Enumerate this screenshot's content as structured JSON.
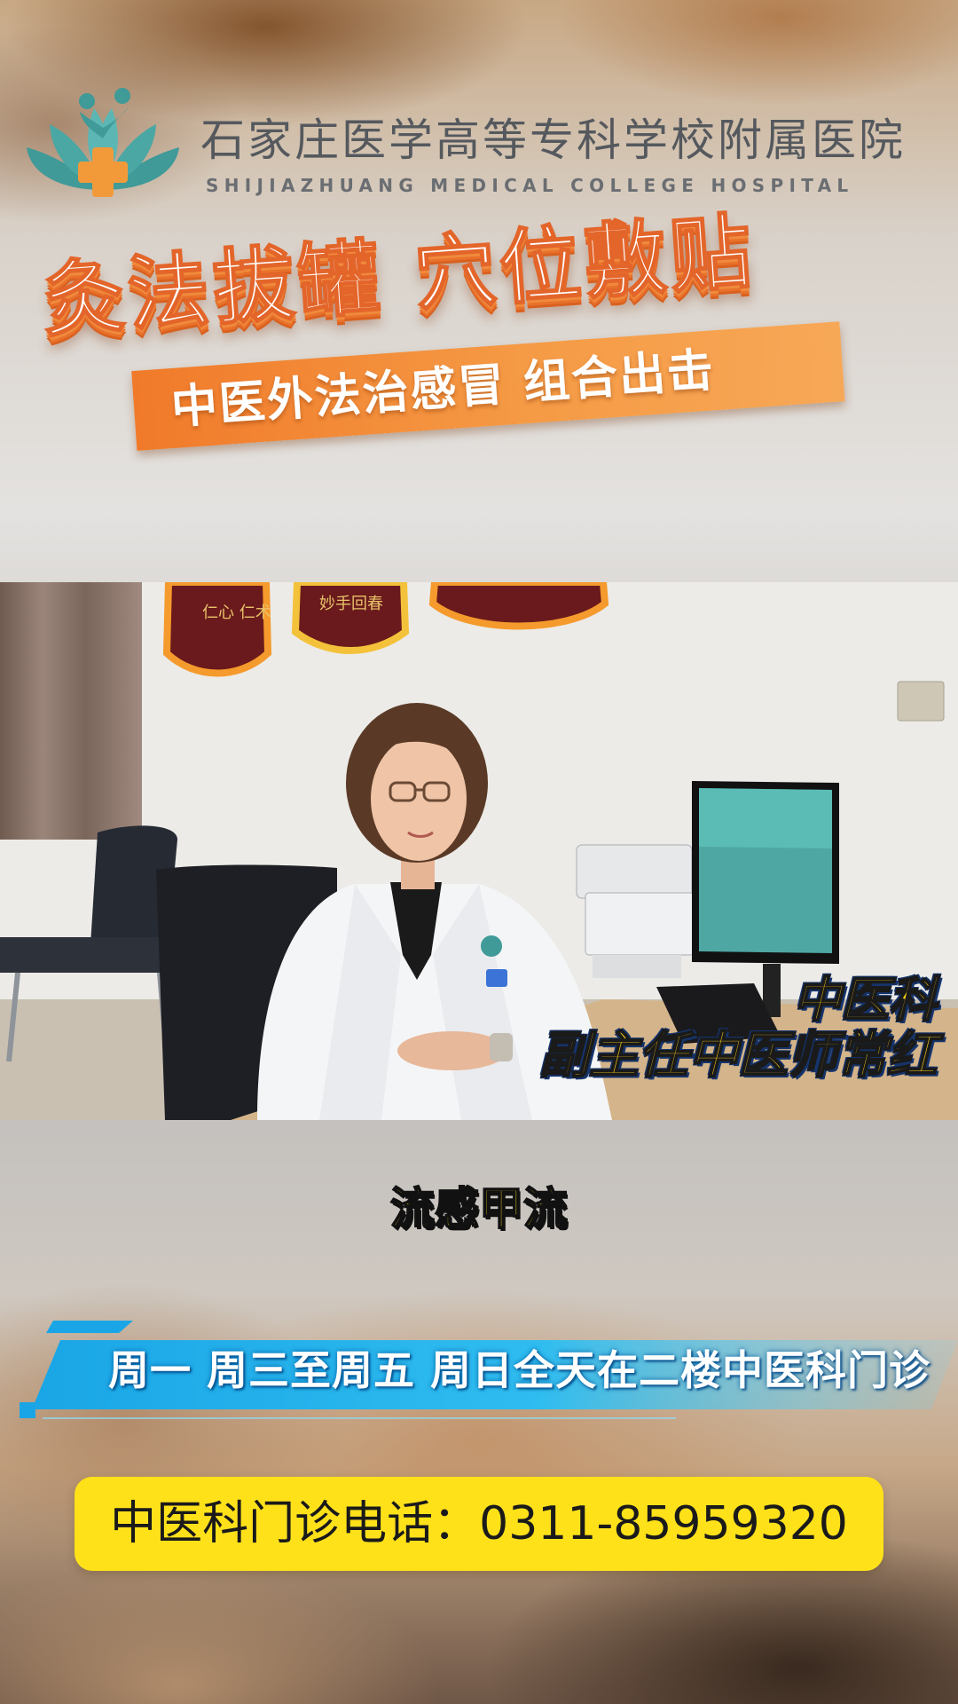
{
  "hospital": {
    "name_cn": "石家庄医学高等专科学校附属医院",
    "name_en": "SHIJIAZHUANG MEDICAL COLLEGE HOSPITAL",
    "logo_icon": "lotus-cross-logo-icon"
  },
  "headline": {
    "main": "灸法拔罐 穴位敷贴",
    "sub": "中医外法治感冒 组合出击"
  },
  "video": {
    "caption_dept": "中医科",
    "caption_title": "副主任中医师常红",
    "plaque_1": "仁心 仁术",
    "plaque_2": "妙手回春"
  },
  "subtitle": "流感甲流",
  "schedule": "周一 周三至周五 周日全天在二楼中医科门诊",
  "phone": "中医科门诊电话：0311-85959320",
  "colors": {
    "accent_orange": "#f07a2a",
    "caption_yellow": "#ffd21a",
    "banner_cyan": "#28b8ec",
    "pill_yellow": "#ffe11a"
  }
}
